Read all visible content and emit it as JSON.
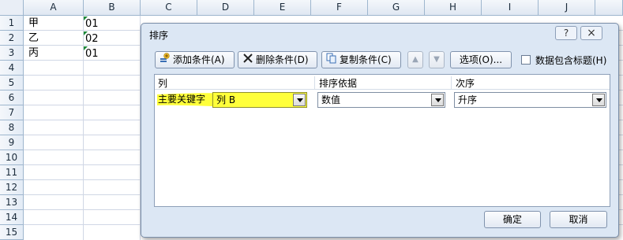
{
  "sheet": {
    "columns": [
      "A",
      "B",
      "C",
      "D",
      "E",
      "F",
      "G",
      "H",
      "I",
      "J"
    ],
    "rows": [
      "1",
      "2",
      "3",
      "4",
      "5",
      "6",
      "7",
      "8",
      "9",
      "10",
      "11",
      "12",
      "13",
      "14",
      "15"
    ],
    "cells": [
      {
        "a": "甲",
        "b": "01"
      },
      {
        "a": "乙",
        "b": "02"
      },
      {
        "a": "丙",
        "b": "01"
      }
    ]
  },
  "dialog": {
    "title": "排序",
    "help_label": "?",
    "close_label": "×",
    "toolbar": {
      "add_label": "添加条件(A)",
      "delete_label": "删除条件(D)",
      "copy_label": "复制条件(C)",
      "options_label": "选项(O)...",
      "header_checkbox_label": "数据包含标题(H)"
    },
    "list": {
      "headers": {
        "column": "列",
        "sort_on": "排序依据",
        "order": "次序"
      },
      "row": {
        "label": "主要关键字",
        "column_value": "列 B",
        "sort_on_value": "数值",
        "order_value": "升序"
      }
    },
    "ok_label": "确定",
    "cancel_label": "取消"
  },
  "colors": {
    "highlight": "#ffff3a",
    "dialog_bg": "#dce7f4"
  }
}
